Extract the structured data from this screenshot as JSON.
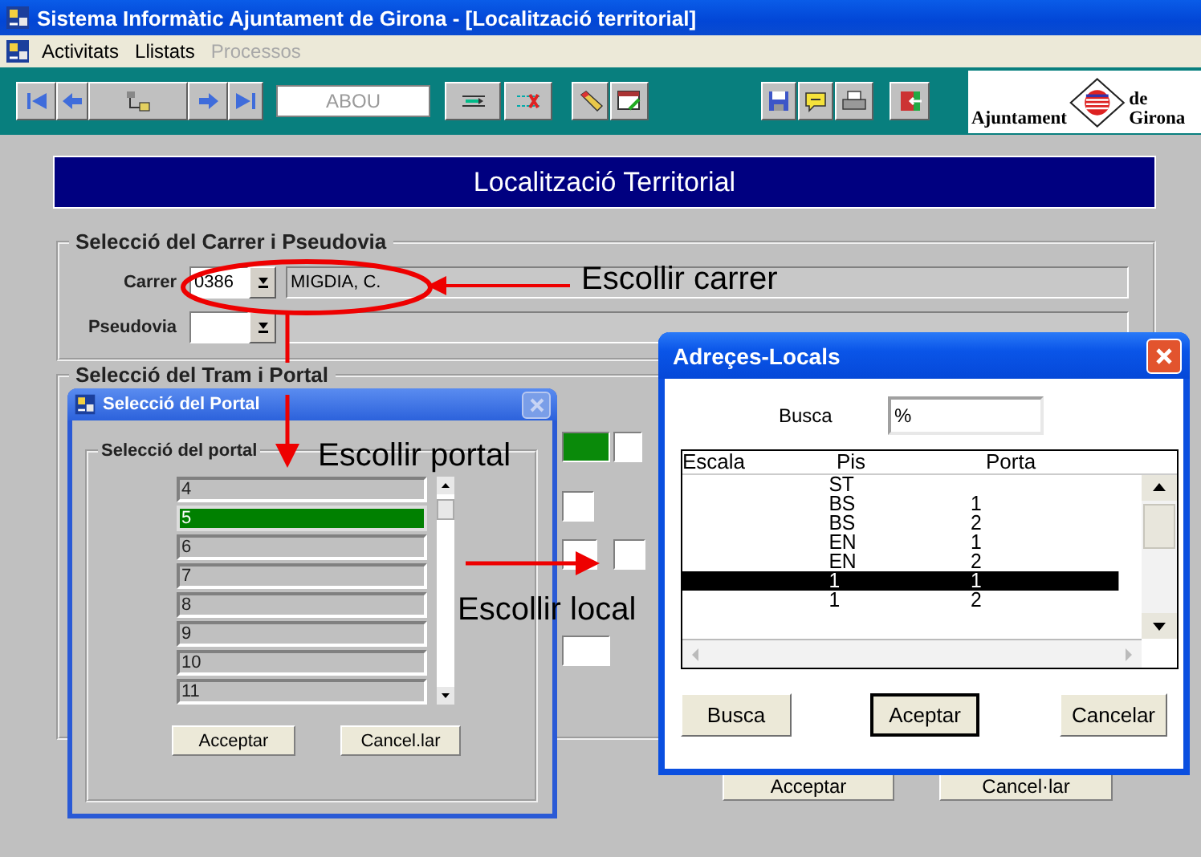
{
  "app_window": {
    "title": "Sistema Informàtic Ajuntament de Girona - [Localització territorial]"
  },
  "menu": [
    {
      "label": "Activitats",
      "disabled": false
    },
    {
      "label": "Llistats",
      "disabled": false
    },
    {
      "label": "Processos",
      "disabled": true
    }
  ],
  "toolbar": {
    "field_value": "ABOU",
    "logo_words": [
      "Ajuntament",
      "de Girona"
    ]
  },
  "form": {
    "header": "Localització Territorial",
    "street_group": {
      "title": "Selecció del Carrer i Pseudovia",
      "carrer_label": "Carrer",
      "carrer_code": "0386",
      "carrer_name": "MIGDIA, C.",
      "pseudovia_label": "Pseudovia"
    },
    "section_group": {
      "title": "Selecció del Tram i Portal"
    },
    "buttons": [
      "Acceptar",
      "Cancel·lar"
    ]
  },
  "portal_dialog": {
    "title": "Selecció del Portal",
    "group_title": "Selecció del portal",
    "items": [
      {
        "label": "4",
        "selected": false
      },
      {
        "label": "5",
        "selected": true
      },
      {
        "label": "6",
        "selected": false
      },
      {
        "label": "7",
        "selected": false
      },
      {
        "label": "8",
        "selected": false
      },
      {
        "label": "9",
        "selected": false
      },
      {
        "label": "10",
        "selected": false
      },
      {
        "label": "11",
        "selected": false
      }
    ],
    "buttons": [
      "Acceptar",
      "Cancel.lar"
    ]
  },
  "locals_dialog": {
    "title": "Adreçes-Locals",
    "search_label": "Busca",
    "search_value": "%",
    "columns": [
      "Escala",
      "Pis",
      "Porta"
    ],
    "rows": [
      {
        "pis": "ST",
        "selected": false
      },
      {
        "pis": "BS",
        "porta": "1",
        "selected": false
      },
      {
        "pis": "BS",
        "porta": "2",
        "selected": false
      },
      {
        "pis": "EN",
        "porta": "1",
        "selected": false
      },
      {
        "pis": "EN",
        "porta": "2",
        "selected": false
      },
      {
        "pis": "1",
        "porta": "1",
        "selected": true
      },
      {
        "pis": "1",
        "porta": "2",
        "selected": false
      }
    ],
    "buttons": [
      "Busca",
      "Aceptar",
      "Cancelar"
    ]
  },
  "annotations": [
    {
      "text": "Escollir carrer"
    },
    {
      "text": "Escollir portal"
    },
    {
      "text": "Escollir local"
    }
  ]
}
